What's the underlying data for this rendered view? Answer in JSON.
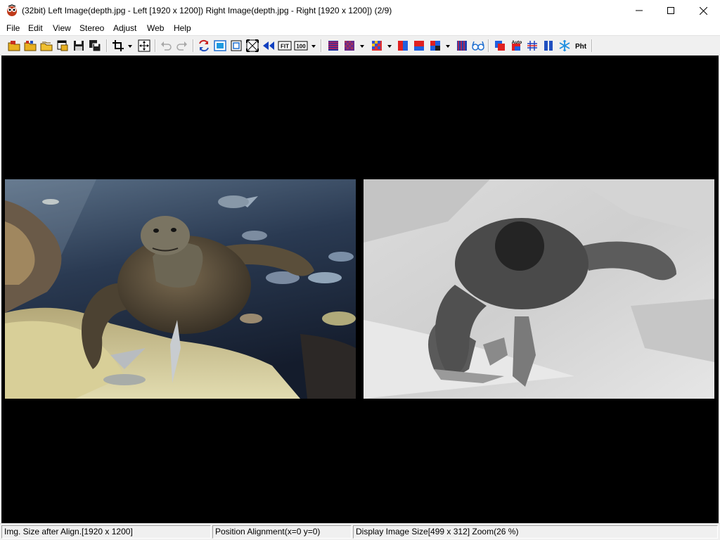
{
  "window": {
    "title": "(32bit) Left Image(depth.jpg - Left [1920 x 1200]) Right Image(depth.jpg - Right [1920 x 1200])  (2/9)"
  },
  "menu": {
    "items": [
      "File",
      "Edit",
      "View",
      "Stereo",
      "Adjust",
      "Web",
      "Help"
    ]
  },
  "toolbar": {
    "icons": [
      "open-folder-icon",
      "open-stereo-icon",
      "open-multi-icon",
      "open-window-icon",
      "save-icon",
      "save-all-icon",
      "crop-icon",
      "crop-dropdown-icon",
      "move-icon",
      "undo-icon",
      "redo-icon",
      "swap-lr-icon",
      "fit-window-icon",
      "full-frame-icon",
      "fullscreen-icon",
      "mirror-arrows-icon",
      "fit-icon",
      "zoom-100-icon",
      "anaglyph-interlaced-icon",
      "anaglyph-checker-icon",
      "anaglyph-color-icon",
      "side-by-side-red-blue-icon",
      "side-by-side-blue-red-icon",
      "quad-color-icon",
      "stripe-icon",
      "glasses-icon",
      "auto-align-icon",
      "auto-color-icon",
      "grid-icon",
      "two-panel-icon",
      "snowflake-icon",
      "pht-icon"
    ],
    "fit_label": "FIT",
    "zoom_label": "100",
    "auto_label": "Auto",
    "pht_label": "Pht"
  },
  "images": {
    "left": {
      "name": "depth.jpg - Left",
      "size": "1920 x 1200",
      "content": "sea-turtle-photo"
    },
    "right": {
      "name": "depth.jpg - Right",
      "size": "1920 x 1200",
      "content": "depth-map"
    }
  },
  "status": {
    "img_size": "Img. Size after Align.[1920 x 1200]",
    "position": "Position Alignment(x=0 y=0)",
    "display": "Display Image Size[499 x 312]  Zoom(26 %)"
  },
  "colors": {
    "viewport_bg": "#000000",
    "chrome_bg": "#f0f0f0"
  }
}
